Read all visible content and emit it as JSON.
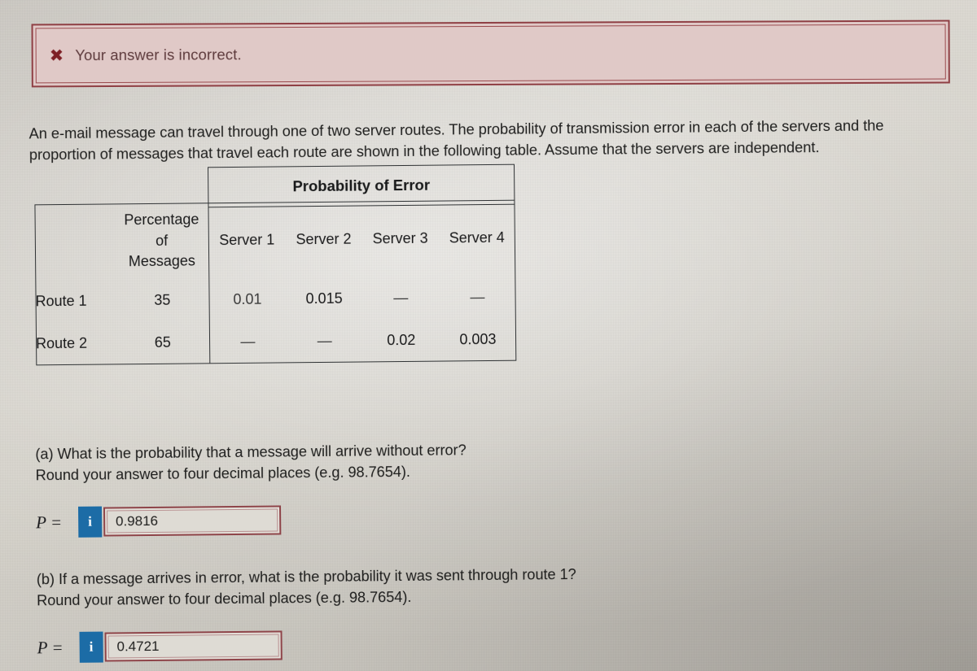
{
  "banner": {
    "icon": "x-mark-icon",
    "message": "Your answer is incorrect.",
    "border_color": "#8f3f44",
    "background_color": "#e0c9c7",
    "text_color": "#5d3a3c"
  },
  "problem": {
    "statement": "An e-mail message can travel through one of two server routes. The probability of transmission error in each of the servers and the proportion of messages that travel each route are shown in the following table. Assume that the servers are independent."
  },
  "table": {
    "group_header": "Probability of Error",
    "row_label_header": "",
    "percentage_header": "Percentage of Messages",
    "percentage_header_lines": [
      "Percentage",
      "of",
      "Messages"
    ],
    "server_headers": [
      "Server 1",
      "Server 2",
      "Server 3",
      "Server 4"
    ],
    "rows": [
      {
        "route": "Route 1",
        "percentage": "35",
        "servers": [
          "0.01",
          "0.015",
          "—",
          "—"
        ]
      },
      {
        "route": "Route 2",
        "percentage": "65",
        "servers": [
          "—",
          "—",
          "0.02",
          "0.003"
        ]
      }
    ]
  },
  "questions": [
    {
      "id": "part-a",
      "line1": "(a) What is the probability that a message will arrive without error?",
      "line2": "Round your answer to four decimal places (e.g. 98.7654).",
      "answer_label": "P =",
      "info_button": "i",
      "answer_value": "0.9816"
    },
    {
      "id": "part-b",
      "line1": "(b) If a message arrives in error, what is the probability it was sent through route 1?",
      "line2": "Round your answer to four decimal places (e.g. 98.7654).",
      "answer_label": "P =",
      "info_button": "i",
      "answer_value": "0.4721"
    }
  ],
  "theme": {
    "info_button_blue": "#1c6ca6",
    "field_border_red": "#8e4449",
    "page_background": "#d6d3cc"
  }
}
